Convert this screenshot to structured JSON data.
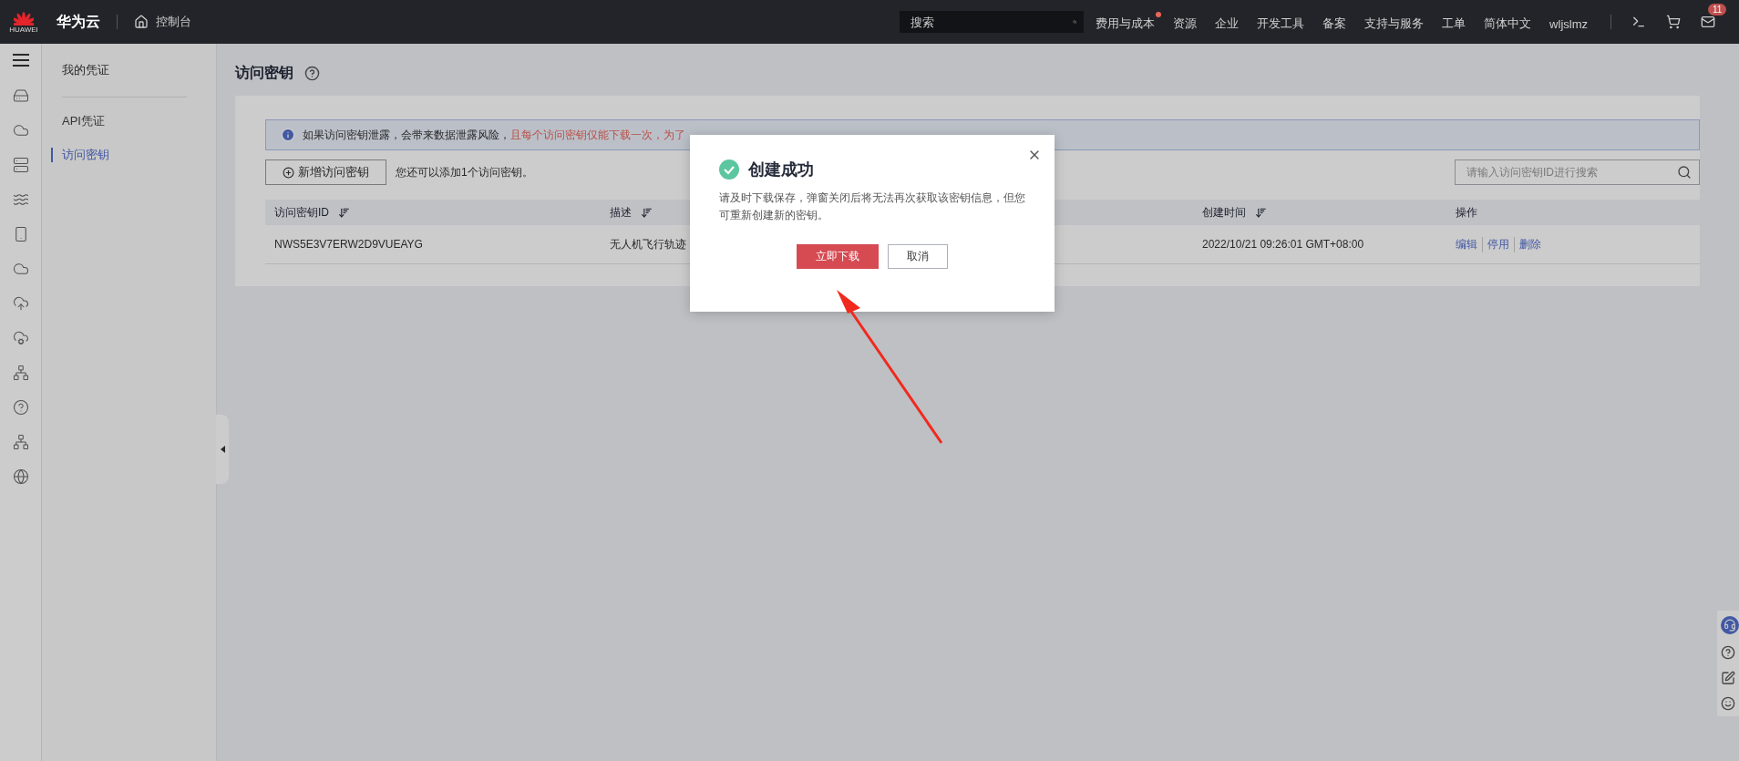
{
  "topbar": {
    "brand": "华为云",
    "logo_text": "HUAWEI",
    "console": "控制台",
    "search": {
      "placeholder": "搜索"
    },
    "nav": [
      {
        "label": "费用与成本",
        "dot": true
      },
      {
        "label": "资源",
        "dot": false
      },
      {
        "label": "企业",
        "dot": false
      },
      {
        "label": "开发工具",
        "dot": false
      },
      {
        "label": "备案",
        "dot": false
      },
      {
        "label": "支持与服务",
        "dot": false
      },
      {
        "label": "工单",
        "dot": false
      },
      {
        "label": "简体中文",
        "dot": false
      },
      {
        "label": "wljslmz",
        "dot": false
      }
    ],
    "mail_badge": "11"
  },
  "sidebar": {
    "title": "我的凭证",
    "items": [
      {
        "label": "API凭证",
        "selected": false
      },
      {
        "label": "访问密钥",
        "selected": true
      }
    ]
  },
  "page": {
    "title": "访问密钥",
    "alert": {
      "text": "如果访问密钥泄露，会带来数据泄露风险，",
      "warning": "且每个访问密钥仅能下载一次，为了"
    },
    "add_button": "新增访问密钥",
    "quota_note": "您还可以添加1个访问密钥。",
    "search": {
      "placeholder": "请输入访问密钥ID进行搜索"
    },
    "table": {
      "columns": [
        {
          "label": "访问密钥ID",
          "sortable": true
        },
        {
          "label": "描述",
          "sortable": true
        },
        {
          "sortable": false
        },
        {
          "label": "创建时间",
          "sortable": true
        },
        {
          "label": "操作",
          "sortable": false
        }
      ],
      "rows": [
        {
          "id": "NWS5E3V7ERW2D9VUEAYG",
          "description": "无人机飞行轨迹",
          "created": "2022/10/21 09:26:01 GMT+08:00",
          "actions": [
            "编辑",
            "停用",
            "删除"
          ]
        }
      ]
    }
  },
  "dialog": {
    "title": "创建成功",
    "message": "请及时下载保存，弹窗关闭后将无法再次获取该密钥信息，但您可重新创建新的密钥。",
    "buttons": [
      {
        "label": "立即下载",
        "kind": "primary"
      },
      {
        "label": "取消",
        "kind": "secondary"
      }
    ]
  }
}
